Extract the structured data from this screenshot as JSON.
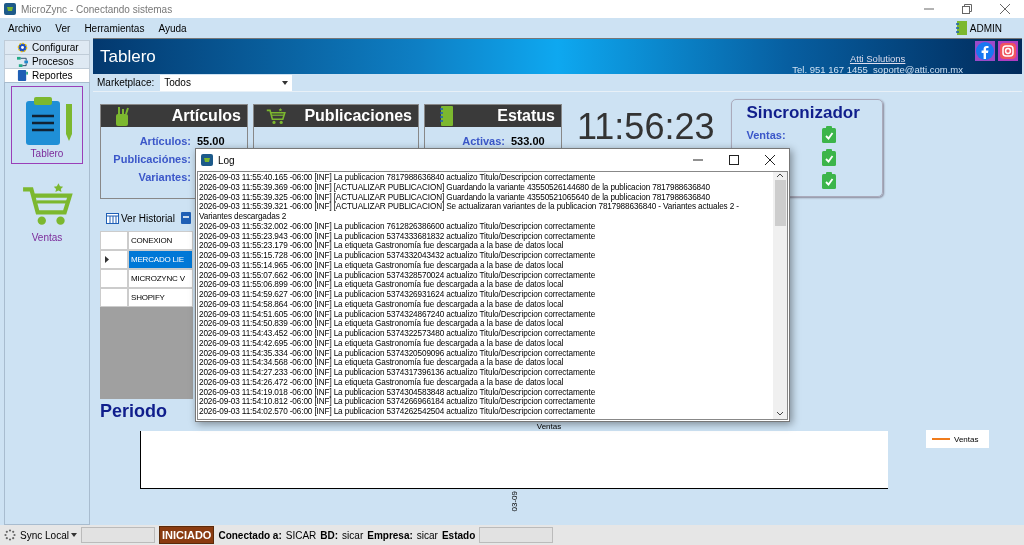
{
  "window": {
    "title": "MicroZync - Conectando sistemas"
  },
  "menu": [
    "Archivo",
    "Ver",
    "Herramientas",
    "Ayuda"
  ],
  "user": "ADMIN",
  "sidebar": {
    "tabs": [
      {
        "label": "Configurar",
        "kind": "gear",
        "selected": false
      },
      {
        "label": "Procesos",
        "kind": "flow",
        "selected": false
      },
      {
        "label": "Reportes",
        "kind": "book",
        "selected": true
      }
    ],
    "items": [
      {
        "label": "Tablero",
        "kind": "clipboard",
        "selected": true
      },
      {
        "label": "Ventas",
        "kind": "cart",
        "selected": false
      }
    ]
  },
  "header": {
    "title": "Tablero",
    "company": "Atti Solutions",
    "contact": "Tel. 951 167 1455  soporte@atti.com.mx"
  },
  "filter": {
    "label": "Marketplace:",
    "value": "Todos"
  },
  "cards": [
    {
      "title": "Artículos",
      "kind": "pencils",
      "rows": [
        {
          "label": "Artículos:",
          "value": "55.00"
        },
        {
          "label": "Publicaciónes:"
        },
        {
          "label": "Variantes:"
        }
      ]
    },
    {
      "title": "Publicaciones",
      "kind": "cart"
    },
    {
      "title": "Estatus",
      "kind": "notebook",
      "rows": [
        {
          "label": "Activas:",
          "value": "533.00"
        }
      ]
    }
  ],
  "clock": "11:56:23",
  "sync": {
    "title": "Sincronizador",
    "rows": [
      {
        "label": "Ventas:",
        "ok": true
      },
      {
        "ok": true
      },
      {
        "ok": true
      }
    ]
  },
  "grid_toolbar": [
    {
      "kind": "table",
      "label": "Ver Historial"
    },
    {
      "kind": "doc"
    }
  ],
  "grid": {
    "columns": [
      "CONEXION"
    ],
    "rows": [
      {
        "cells": [
          "MERCADO LIE"
        ],
        "selected": true
      },
      {
        "cells": [
          "MICROZYNC V"
        ],
        "selected": false
      },
      {
        "cells": [
          "SHOPIFY"
        ],
        "selected": false
      }
    ]
  },
  "period": {
    "label": "Periodo"
  },
  "chart": {
    "title": "Ventas",
    "legend": "Ventas",
    "x_label": "03-09"
  },
  "log": {
    "title": "Log",
    "lines": [
      "2026-09-03 11:55:40.165 -06:00 [INF] La publicacion 7817988636840 actualizo Titulo/Descripcion correctamente",
      "2026-09-03 11:55:39.369 -06:00 [INF] [ACTUALIZAR PUBLICACION]  Guardando la variante 43550526144680 de la publicacion 7817988636840",
      "2026-09-03 11:55:39.325 -06:00 [INF] [ACTUALIZAR PUBLICACION]  Guardando la variante 43550521065640 de la publicacion 7817988636840",
      "2026-09-03 11:55:39.321 -06:00 [INF] [ACTUALIZAR PUBLICACION]  Se actualizaran variantes de la publicacion 7817988636840 - Variantes actuales 2 - Variantes descargadas 2",
      "2026-09-03 11:55:32.002 -06:00 [INF] La publicacion 7612826386600 actualizo Titulo/Descripcion correctamente",
      "2026-09-03 11:55:23.943 -06:00 [INF] La publicacion 5374333681832 actualizo Titulo/Descripcion correctamente",
      "2026-09-03 11:55:23.179 -06:00 [INF] La etiqueta Gastronomía fue descargada a la base de datos local",
      "2026-09-03 11:55:15.728 -06:00 [INF] La publicacion 5374332043432 actualizo Titulo/Descripcion correctamente",
      "2026-09-03 11:55:14.965 -06:00 [INF] La etiqueta Gastronomía fue descargada a la base de datos local",
      "2026-09-03 11:55:07.662 -06:00 [INF] La publicacion 5374328570024 actualizo Titulo/Descripcion correctamente",
      "2026-09-03 11:55:06.899 -06:00 [INF] La etiqueta Gastronomía fue descargada a la base de datos local",
      "2026-09-03 11:54:59.627 -06:00 [INF] La publicacion 5374326931624 actualizo Titulo/Descripcion correctamente",
      "2026-09-03 11:54:58.864 -06:00 [INF] La etiqueta Gastronomía fue descargada a la base de datos local",
      "2026-09-03 11:54:51.605 -06:00 [INF] La publicacion 5374324867240 actualizo Titulo/Descripcion correctamente",
      "2026-09-03 11:54:50.839 -06:00 [INF] La etiqueta Gastronomía fue descargada a la base de datos local",
      "2026-09-03 11:54:43.452 -06:00 [INF] La publicacion 5374322573480 actualizo Titulo/Descripcion correctamente",
      "2026-09-03 11:54:42.695 -06:00 [INF] La etiqueta Gastronomía fue descargada a la base de datos local",
      "2026-09-03 11:54:35.334 -06:00 [INF] La publicacion 5374320509096 actualizo Titulo/Descripcion correctamente",
      "2026-09-03 11:54:34.568 -06:00 [INF] La etiqueta Gastronomía fue descargada a la base de datos local",
      "2026-09-03 11:54:27.233 -06:00 [INF] La publicacion 5374317396136 actualizo Titulo/Descripcion correctamente",
      "2026-09-03 11:54:26.472 -06:00 [INF] La etiqueta Gastronomía fue descargada a la base de datos local",
      "2026-09-03 11:54:19.018 -06:00 [INF] La publicacion 5374304583848 actualizo Titulo/Descripcion correctamente",
      "2026-09-03 11:54:10.812 -06:00 [INF] La publicacion 5374266966184 actualizo Titulo/Descripcion correctamente",
      "2026-09-03 11:54:02.570 -06:00 [INF] La publicacion 5374262542504 actualizo Titulo/Descripcion correctamente"
    ]
  },
  "status": {
    "sync": "Sync Local",
    "state": "INICIADO",
    "fields": [
      {
        "label": "Conectado a:",
        "value": "SICAR"
      },
      {
        "label": "BD:",
        "value": "sicar"
      },
      {
        "label": "Empresa:",
        "value": "sicar"
      },
      {
        "label": "Estado"
      }
    ]
  }
}
